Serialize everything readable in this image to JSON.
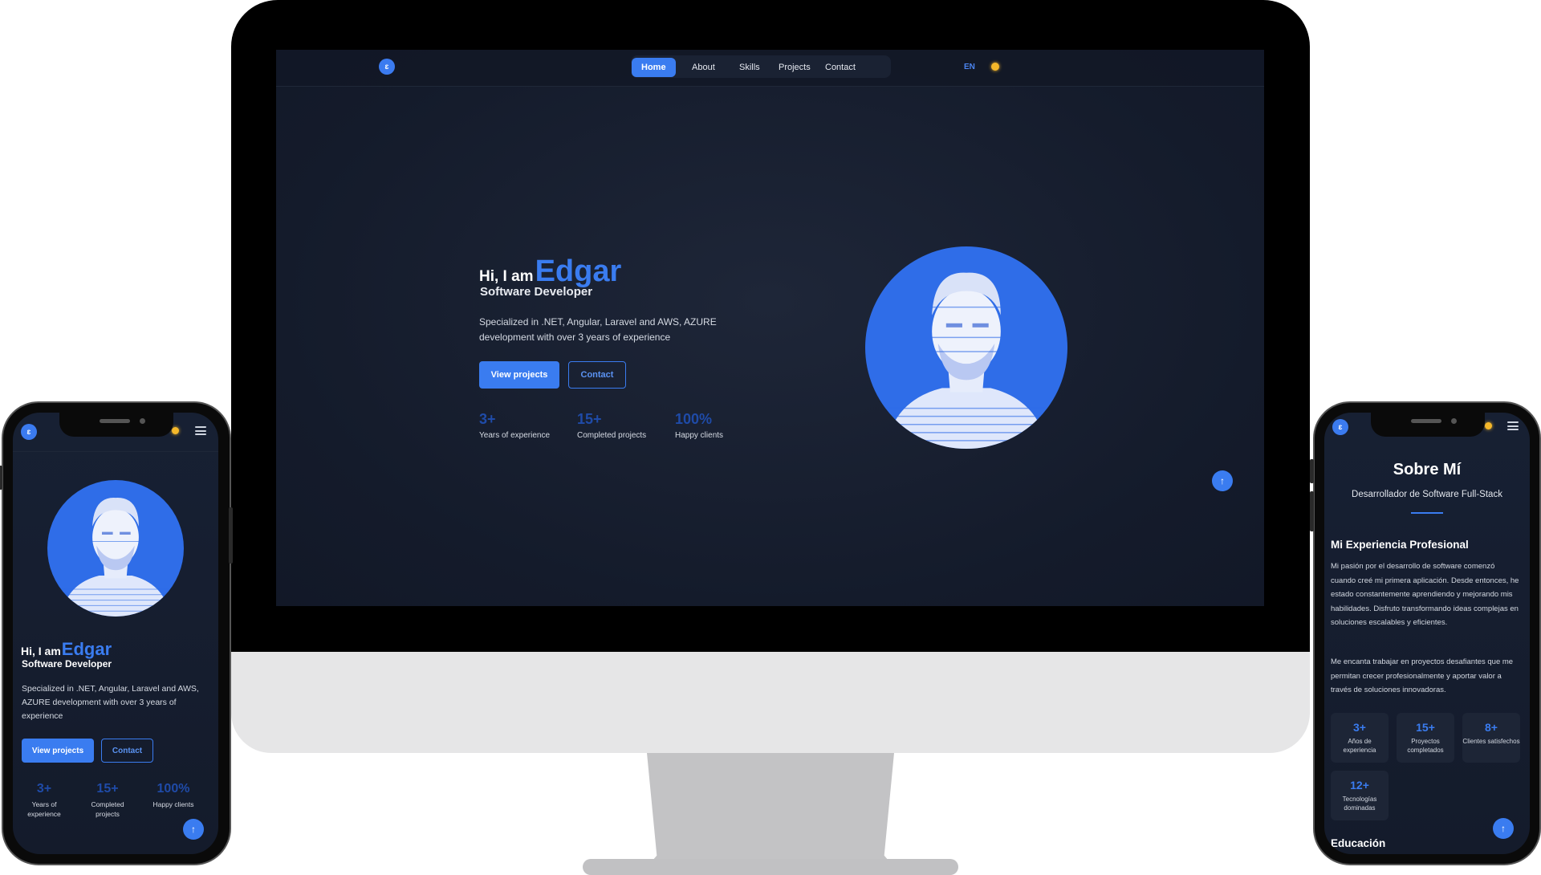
{
  "logo_text": "ɛ",
  "nav": {
    "items": [
      "Home",
      "About",
      "Skills",
      "Projects",
      "Contact"
    ],
    "active": "Home",
    "lang": "EN"
  },
  "hero": {
    "greeting": "Hi, I am",
    "name": "Edgar",
    "role": "Software Developer",
    "description": "Specialized in .NET, Angular, Laravel and AWS, AZURE development with over 3 years of experience",
    "primary_button": "View projects",
    "secondary_button": "Contact",
    "stats": [
      {
        "value": "3+",
        "label": "Years of experience"
      },
      {
        "value": "15+",
        "label": "Completed projects"
      },
      {
        "value": "100%",
        "label": "Happy clients"
      }
    ]
  },
  "mobile_hero": {
    "stat_labels": [
      "Years of experience",
      "Completed projects",
      "Happy clients"
    ]
  },
  "scroll_top_icon": "↑",
  "about": {
    "title": "Sobre Mí",
    "subtitle": "Desarrollador de Software Full-Stack",
    "experience_heading": "Mi Experiencia Profesional",
    "paragraph1": "Mi pasión por el desarrollo de software comenzó cuando creé mi primera aplicación. Desde entonces, he estado constantemente aprendiendo y mejorando mis habilidades. Disfruto transformando ideas complejas en soluciones escalables y eficientes.",
    "paragraph2": "Me encanta trabajar en proyectos desafiantes que me permitan crecer profesionalmente y aportar valor a través de soluciones innovadoras.",
    "stats": [
      {
        "value": "3+",
        "label": "Años de experiencia"
      },
      {
        "value": "15+",
        "label": "Proyectos completados"
      },
      {
        "value": "8+",
        "label": "Clientes satisfechos"
      },
      {
        "value": "12+",
        "label": "Tecnologías dominadas"
      }
    ],
    "education_heading": "Educación"
  },
  "colors": {
    "accent": "#3a7cf0",
    "background": "#141b2b",
    "sun": "#f5b82a"
  },
  "icons": [
    "logo-icon",
    "sun-icon",
    "menu-icon",
    "arrow-up-icon"
  ]
}
